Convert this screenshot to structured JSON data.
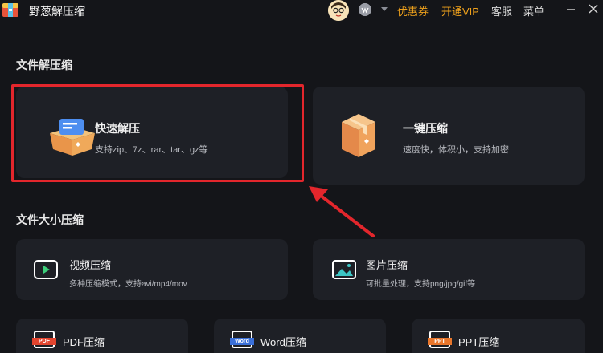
{
  "app": {
    "title": "野葱解压缩"
  },
  "topbar": {
    "coupon": "优惠券",
    "vip": "开通VIP",
    "service": "客服",
    "menu": "菜单"
  },
  "sections": {
    "file_extract": "文件解压缩",
    "size_compress": "文件大小压缩"
  },
  "cards": {
    "quick_extract": {
      "title": "快速解压",
      "subtitle": "支持zip、7z、rar、tar、gz等"
    },
    "one_click": {
      "title": "一键压缩",
      "subtitle": "速度快，体积小，支持加密"
    },
    "video": {
      "title": "视频压缩",
      "subtitle": "多种压缩模式，支持avi/mp4/mov"
    },
    "image": {
      "title": "图片压缩",
      "subtitle": "可批量处理，支持png/jpg/gif等"
    },
    "pdf": {
      "title": "PDF压缩",
      "icon_label": "PDF"
    },
    "word": {
      "title": "Word压缩",
      "icon_label": "Word"
    },
    "ppt": {
      "title": "PPT压缩",
      "icon_label": "PPT"
    }
  },
  "colors": {
    "accent": "#f0a21c",
    "highlight": "#e3262c",
    "background": "#141519",
    "card": "#1e2026"
  }
}
